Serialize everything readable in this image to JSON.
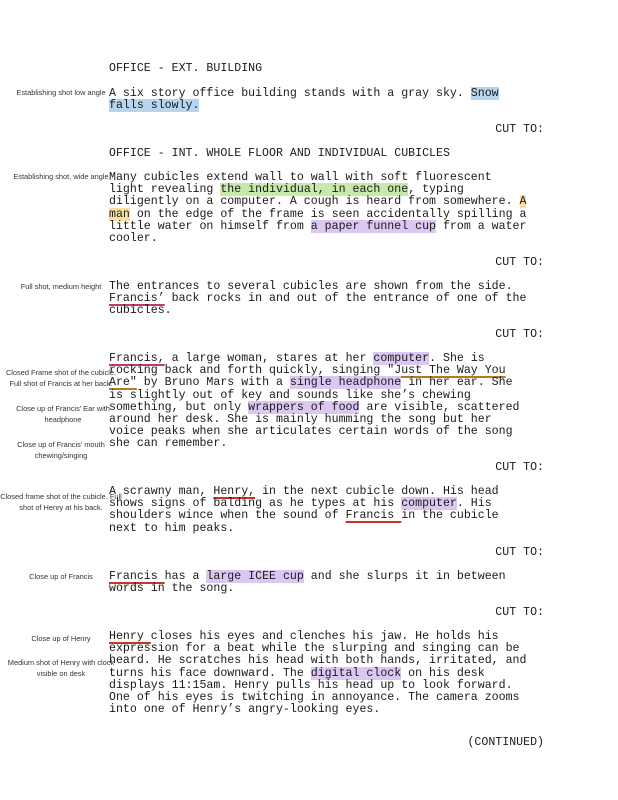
{
  "colors": {
    "highlight_blue": "#b7d5ef",
    "highlight_green": "#c7e9a9",
    "highlight_yellow": "#f8dfa0",
    "highlight_purple": "#dcc7f2",
    "underline_red": "#c4352b",
    "underline_pink": "#c2386f",
    "underline_orange": "#b57b22"
  },
  "transition": "CUT TO:",
  "continued": "(CONTINUED)",
  "scenes": [
    {
      "heading": "OFFICE - EXT. BUILDING",
      "note": "Establishing shot low angle",
      "action": {
        "l1a": "A six story office building stands with a gray sky. ",
        "l1hl": "Snow",
        "l2hl": "falls slowly."
      }
    },
    {
      "heading": "OFFICE - INT. WHOLE FLOOR AND INDIVIDUAL CUBICLES",
      "note": "Establishing shot, wide angle",
      "action": {
        "l1": "Many cubicles extend wall to wall with soft fluorescent",
        "l2a": "light revealing ",
        "l2hl": "the individual, in each one",
        "l2b": ", typing",
        "l3a": "diligently on a computer. A cough is heard from somewhere. ",
        "l3hl": "A",
        "l4hl": "man",
        "l4b": " on the edge of the frame is seen accidentally spilling a",
        "l5a": "little water on himself from ",
        "l5hl": "a paper funnel cup",
        "l5b": " from a water",
        "l6": "cooler."
      }
    },
    {
      "note": "Full shot, medium height",
      "action": {
        "l1": "The entrances to several cubicles are shown from the side.",
        "l2ul": "Francis’",
        "l2b": " back rocks in and out of the entrance of one of the",
        "l3": "cubicles."
      }
    },
    {
      "notes": [
        "Closed Frame shot of the cubicle. Full shot of Francis at her back.",
        "Close up of Francis’ Ear with headphone",
        "Close up of Francis’ mouth chewing/singing"
      ],
      "action": {
        "l1ul": "Francis,",
        "l1a": " a large woman, stares at her ",
        "l1hl": "computer",
        "l1b": ". She is",
        "l2a": "rocking back and forth quickly, singing ",
        "l2ul": "\"Just The Way You",
        "l3ul": "Are\"",
        "l3a": " by Bruno Mars with a ",
        "l3hl": "single headphone",
        "l3b": " in her ear. She",
        "l4": "is slightly out of key and sounds like she’s chewing",
        "l5a": "something, but only ",
        "l5hl": "wrappers of food",
        "l5b": " are visible, scattered",
        "l6": "around her desk. She is mainly humming the song but her",
        "l7": "voice peaks when she articulates certain words of the song",
        "l8": "she can remember."
      }
    },
    {
      "note": "Closed frame shot of the cubicle. Full shot of Henry at his back.",
      "action": {
        "l1a": "A scrawny man, ",
        "l1ul": "Henry,",
        "l1b": " in the next cubicle down. His head",
        "l2a": "shows signs of balding as he types at his ",
        "l2hl": "computer",
        "l2b": ". His",
        "l3a": "shoulders wince when the sound of ",
        "l3ul": "Francis ",
        "l3b": "in the cubicle",
        "l4": "next to him peaks."
      }
    },
    {
      "note": "Close up of Francis",
      "action": {
        "l1ul": "Francis ",
        "l1a": "has a ",
        "l1hl": "large ICEE cup",
        "l1b": " and she slurps it in between",
        "l2": "words in the song."
      }
    },
    {
      "notes": [
        "Close up of Henry",
        "Medium shot of Henry with clock visible on desk"
      ],
      "action": {
        "l1ul": "Henry ",
        "l1a": "closes his eyes and clenches his jaw. He holds his",
        "l2": "expression for a beat while the slurping and singing can be",
        "l3": "heard. He scratches his head with both hands, irritated, and",
        "l4a": "turns his face downward. The ",
        "l4hl": "digital clock",
        "l4b": " on his desk",
        "l5": "displays 11:15am. Henry pulls his head up to look forward.",
        "l6": "One of his eyes is twitching in annoyance. The camera zooms",
        "l7": "into one of Henry’s angry-looking eyes."
      }
    }
  ]
}
